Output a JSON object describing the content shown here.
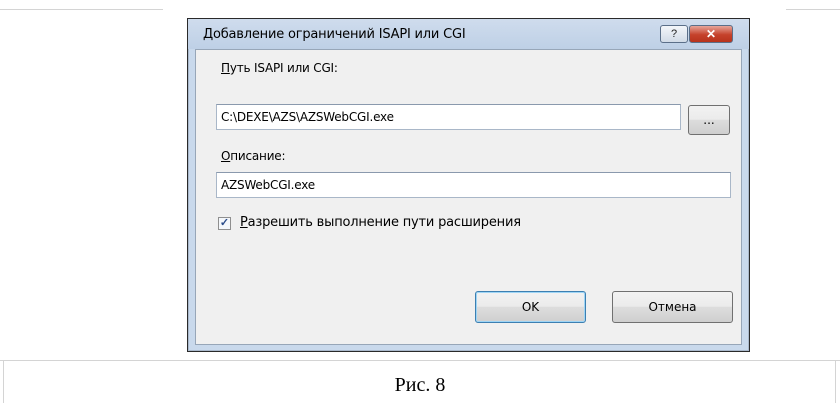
{
  "dialog": {
    "title": "Добавление ограничений ISAPI или CGI",
    "help_glyph": "?",
    "close_glyph": "✕",
    "path_label_accel": "П",
    "path_label_rest": "уть ISAPI или CGI:",
    "path_value": "C:\\DEXE\\AZS\\AZSWebCGI.exe",
    "browse_label": "...",
    "desc_label_accel": "О",
    "desc_label_rest": "писание:",
    "desc_value": "AZSWebCGI.exe",
    "allow_checked": true,
    "allow_label_accel": "Р",
    "allow_label_rest": "азрешить выполнение пути расширения",
    "ok_label": "OK",
    "cancel_label": "Отмена"
  },
  "caption": "Рис. 8"
}
